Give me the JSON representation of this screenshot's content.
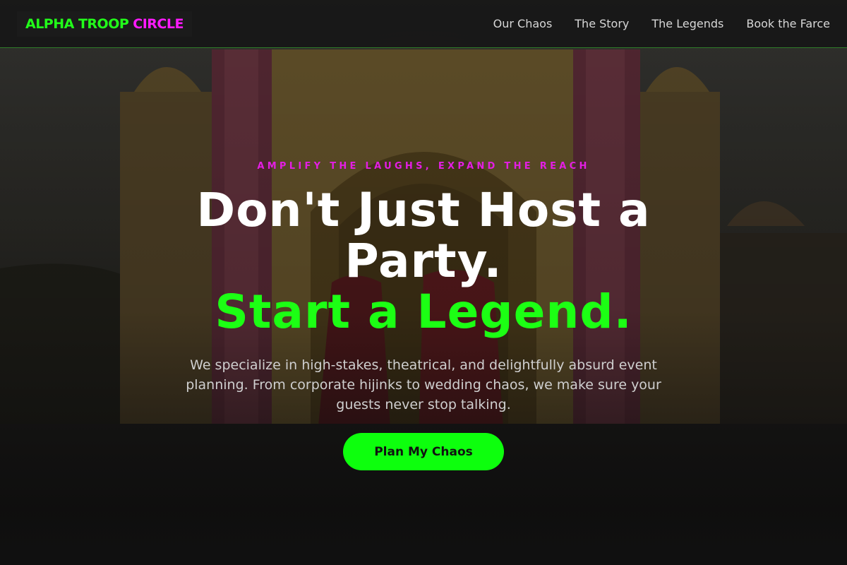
{
  "brand": {
    "part1": "ALPHA TROOP",
    "part2": "CIRCLE",
    "color_primary": "#22ff1a",
    "color_secondary": "#ff1aff"
  },
  "nav": {
    "items": [
      {
        "label": "Our Chaos"
      },
      {
        "label": "The Story"
      },
      {
        "label": "The Legends"
      },
      {
        "label": "Book the Farce"
      }
    ]
  },
  "hero": {
    "eyebrow": "AMPLIFY THE LAUGHS, EXPAND THE REACH",
    "headline_line1": "Don't Just Host a Party.",
    "headline_accent": "Start a Legend.",
    "lead": "We specialize in high-stakes, theatrical, and delightfully absurd event planning. From corporate hijinks to wedding chaos, we make sure your guests never stop talking.",
    "cta_label": "Plan My Chaos",
    "accent_color": "#1cff14"
  }
}
